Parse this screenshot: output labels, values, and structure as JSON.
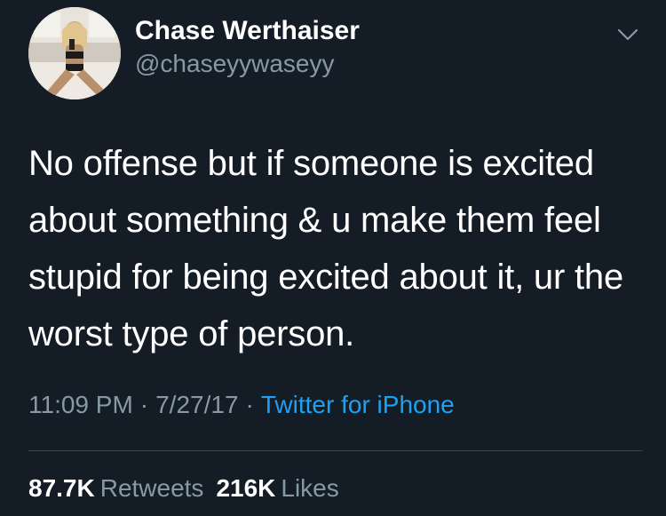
{
  "user": {
    "display_name": "Chase Werthaiser",
    "handle": "@chaseyywaseyy"
  },
  "tweet": {
    "text": "No offense but if someone is excited about something & u make them feel stupid for being excited about it, ur the worst type of person.",
    "time": "11:09 PM",
    "date": "7/27/17",
    "separator": "·",
    "source": "Twitter for iPhone"
  },
  "stats": {
    "retweets_count": "87.7K",
    "retweets_label": "Retweets",
    "likes_count": "216K",
    "likes_label": "Likes"
  },
  "colors": {
    "background": "#141d26",
    "text_primary": "#ffffff",
    "text_secondary": "#8899a6",
    "link": "#1da1f2"
  }
}
